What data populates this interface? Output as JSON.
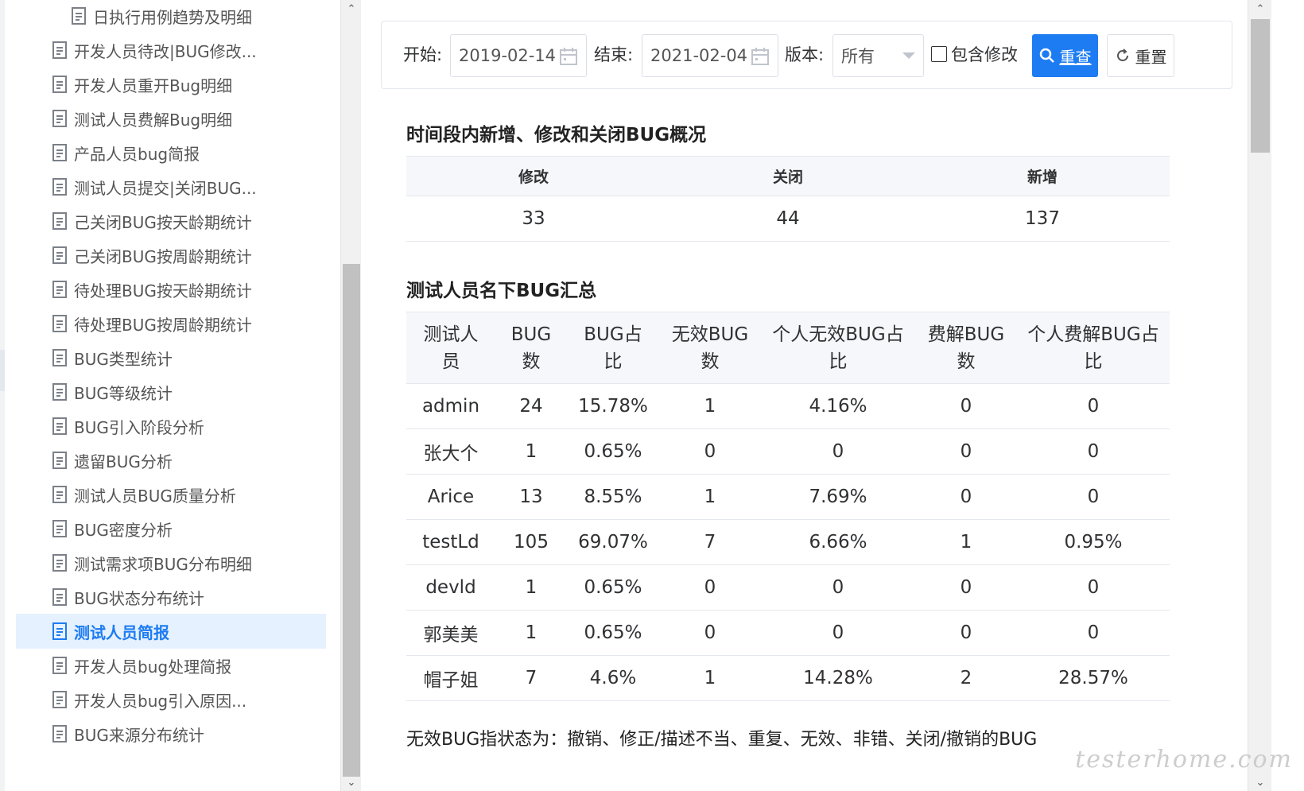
{
  "sidebar": {
    "items": [
      {
        "label": "日执行用例趋势及明细"
      },
      {
        "label": "开发人员待改|BUG修改..."
      },
      {
        "label": "开发人员重开Bug明细"
      },
      {
        "label": "测试人员费解Bug明细"
      },
      {
        "label": "产品人员bug简报"
      },
      {
        "label": "测试人员提交|关闭BUG..."
      },
      {
        "label": "己关闭BUG按天龄期统计"
      },
      {
        "label": "己关闭BUG按周龄期统计"
      },
      {
        "label": "待处理BUG按天龄期统计"
      },
      {
        "label": "待处理BUG按周龄期统计"
      },
      {
        "label": "BUG类型统计"
      },
      {
        "label": "BUG等级统计"
      },
      {
        "label": "BUG引入阶段分析"
      },
      {
        "label": "遗留BUG分析"
      },
      {
        "label": "测试人员BUG质量分析"
      },
      {
        "label": "BUG密度分析"
      },
      {
        "label": "测试需求项BUG分布明细"
      },
      {
        "label": "BUG状态分布统计"
      },
      {
        "label": "测试人员简报",
        "active": true
      },
      {
        "label": "开发人员bug处理简报"
      },
      {
        "label": "开发人员bug引入原因..."
      },
      {
        "label": "BUG来源分布统计"
      }
    ]
  },
  "filter": {
    "start_label": "开始:",
    "start_value": "2019-02-14",
    "end_label": "结束:",
    "end_value": "2021-02-04",
    "version_label": "版本:",
    "version_value": "所有",
    "include_label": "包含修改",
    "search_label": "重查",
    "reset_label": "重置"
  },
  "overview": {
    "title": "时间段内新增、修改和关闭BUG概况",
    "headers": [
      "修改",
      "关闭",
      "新增"
    ],
    "values": [
      "33",
      "44",
      "137"
    ]
  },
  "summary": {
    "title": "测试人员名下BUG汇总",
    "headers": [
      [
        "测试人",
        "员"
      ],
      [
        "BUG",
        "数"
      ],
      [
        "BUG占",
        "比"
      ],
      [
        "无效BUG",
        "数"
      ],
      [
        "个人无效BUG占",
        "比"
      ],
      [
        "费解BUG",
        "数"
      ],
      [
        "个人费解BUG占",
        "比"
      ]
    ],
    "rows": [
      [
        "admin",
        "24",
        "15.78%",
        "1",
        "4.16%",
        "0",
        "0"
      ],
      [
        "张大个",
        "1",
        "0.65%",
        "0",
        "0",
        "0",
        "0"
      ],
      [
        "Arice",
        "13",
        "8.55%",
        "1",
        "7.69%",
        "0",
        "0"
      ],
      [
        "testLd",
        "105",
        "69.07%",
        "7",
        "6.66%",
        "1",
        "0.95%"
      ],
      [
        "devld",
        "1",
        "0.65%",
        "0",
        "0",
        "0",
        "0"
      ],
      [
        "郭美美",
        "1",
        "0.65%",
        "0",
        "0",
        "0",
        "0"
      ],
      [
        "帽子姐",
        "7",
        "4.6%",
        "1",
        "14.28%",
        "2",
        "28.57%"
      ]
    ]
  },
  "note": "无效BUG指状态为：撤销、修正/描述不当、重复、无效、非错、关闭/撤销的BUG",
  "watermark": "testerhome.com",
  "colors": {
    "accent": "#1d7cf2",
    "active_bg": "#e6f1ff",
    "header_bg": "#f5f7fa"
  }
}
